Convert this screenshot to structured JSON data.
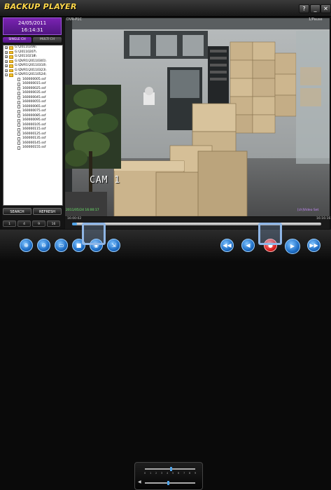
{
  "window": {
    "title": "BACKUP PLAYER",
    "help_label": "?",
    "minimize_label": "_",
    "close_label": "✕"
  },
  "datetime": {
    "date": "24/05/2011",
    "time": "16:14:31"
  },
  "mode_tabs": {
    "single": "SINGLE CH",
    "multi": "MULTI CH"
  },
  "tree": {
    "folders": [
      "G:\\20110206\\",
      "G:\\20110207\\",
      "G:\\20110218\\",
      "G:\\DVR1\\20110301\\",
      "G:\\DVR1\\20110310\\",
      "G:\\DVR1\\20110323\\",
      "G:\\DVR1\\20110524\\"
    ],
    "files": [
      "160000005.ssf",
      "160000015.ssf",
      "160000025.ssf",
      "160000035.ssf",
      "160000045.ssf",
      "160000055.ssf",
      "160000065.ssf",
      "160000075.ssf",
      "160000085.ssf",
      "160000095.ssf",
      "160000105.ssf",
      "160000115.ssf",
      "160000125.ssf",
      "160000135.ssf",
      "160000145.ssf",
      "160000155.ssf"
    ]
  },
  "buttons": {
    "search": "SEARCH",
    "refresh": "REFRESH"
  },
  "split_buttons": [
    "1",
    "4",
    "9",
    "16"
  ],
  "video": {
    "header_left": "DVR-P1C",
    "header_right": "1/Pause",
    "cam_label": "CAM 1",
    "timestamp": "2011/05/24 16:00:17",
    "status_right": "[ch]Video Set"
  },
  "timeline": {
    "start": "16:00:02",
    "end": "16:16:16",
    "progress": 0.02
  },
  "audio": {
    "ticks": [
      "0",
      "1",
      "2",
      "3",
      "4",
      "5",
      "6",
      "7",
      "8",
      "9"
    ],
    "volume_level": 0.45
  },
  "colors": {
    "accent_purple": "#6a1fa0",
    "title_yellow": "#ffd84a",
    "playback_blue": "#1e6ec6",
    "record_red": "#e03030",
    "highlight": "#8fb6e6"
  },
  "icons": {
    "zoom_in": "zoom-in-icon",
    "zoom_out": "zoom-out-icon",
    "print": "print-icon",
    "save": "save-icon",
    "snapshot": "snapshot-icon",
    "export": "export-icon",
    "rewind": "rewind-icon",
    "step_back": "step-back-icon",
    "record": "record-icon",
    "play": "play-icon",
    "fast_forward": "fast-forward-icon"
  }
}
